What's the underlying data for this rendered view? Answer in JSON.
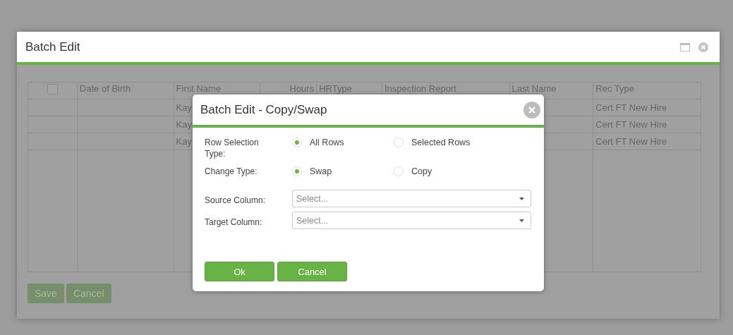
{
  "window": {
    "title": "Batch Edit"
  },
  "table": {
    "select_all": {
      "checked": false
    },
    "columns": [
      "Date of Birth",
      "First Name",
      "Hours",
      "HRType",
      "Inspection Report",
      "Last Name",
      "Rec Type"
    ],
    "rows": [
      {
        "first_name": "Kay",
        "rec_type": "Cert FT New Hire"
      },
      {
        "first_name": "Kay",
        "rec_type": "Cert FT New Hire"
      },
      {
        "first_name": "Kay",
        "rec_type": "Cert FT New Hire"
      }
    ]
  },
  "buttons": [
    "Save",
    "Cancel"
  ],
  "dialog": {
    "title": "Batch Edit - Copy/Swap",
    "fields": [
      {
        "kind": "radio",
        "label": "Row Selection Type:",
        "options": [
          {
            "label": "All Rows",
            "selected": true
          },
          {
            "label": "Selected Rows",
            "selected": false
          }
        ]
      },
      {
        "kind": "radio",
        "label": "Change Type:",
        "options": [
          {
            "label": "Swap",
            "selected": true
          },
          {
            "label": "Copy",
            "selected": false
          }
        ]
      },
      {
        "kind": "select",
        "label": "Source Column:",
        "placeholder": "Select..."
      },
      {
        "kind": "select",
        "label": "Target Column:",
        "placeholder": "Select..."
      }
    ],
    "buttons": [
      "Ok",
      "Cancel"
    ]
  }
}
